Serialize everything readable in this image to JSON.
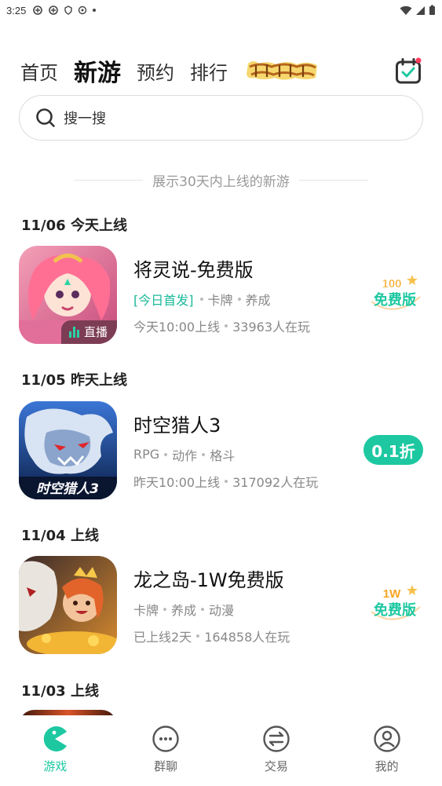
{
  "status_bar": {
    "time": "3:25"
  },
  "top_nav": {
    "tabs": [
      {
        "label": "首页"
      },
      {
        "label": "新游"
      },
      {
        "label": "预约"
      },
      {
        "label": "排行"
      }
    ],
    "logo_text": "阿尔法战纪"
  },
  "search": {
    "placeholder": "搜一搜"
  },
  "notice": "展示30天内上线的新游",
  "sections": [
    {
      "date": "11/06 今天上线"
    },
    {
      "date": "11/05 昨天上线"
    },
    {
      "date": "11/04 上线"
    },
    {
      "date": "11/03 上线"
    }
  ],
  "games": [
    {
      "title": "将灵说-免费版",
      "highlight_tag": "[今日首发]",
      "tags": [
        "卡牌",
        "养成"
      ],
      "time": "今天10:00上线",
      "players": "33963人在玩",
      "live_label": "直播",
      "badge_top": "100",
      "badge_bottom": "免费版"
    },
    {
      "title": "时空猎人3",
      "tags": [
        "RPG",
        "动作",
        "格斗"
      ],
      "time": "昨天10:00上线",
      "players": "317092人在玩",
      "discount": "0.1折",
      "icon_text": "时空猎人3"
    },
    {
      "title": "龙之岛-1W免费版",
      "tags": [
        "卡牌",
        "养成",
        "动漫"
      ],
      "time": "已上线2天",
      "players": "164858人在玩",
      "badge_top": "1W",
      "badge_bottom": "免费版"
    }
  ],
  "bottom_nav": [
    {
      "label": "游戏"
    },
    {
      "label": "群聊"
    },
    {
      "label": "交易"
    },
    {
      "label": "我的"
    }
  ],
  "colors": {
    "accent": "#1dc8a1",
    "badge_orange": "#f6a623"
  }
}
